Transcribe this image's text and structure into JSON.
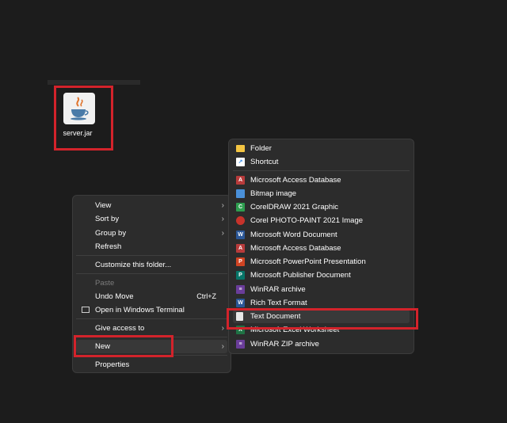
{
  "desktop": {
    "file": {
      "name": "server.jar",
      "icon": "java-icon"
    }
  },
  "context_menu": {
    "items": [
      {
        "label": "View",
        "has_submenu": true
      },
      {
        "label": "Sort by",
        "has_submenu": true
      },
      {
        "label": "Group by",
        "has_submenu": true
      },
      {
        "label": "Refresh"
      },
      {
        "label": "Customize this folder..."
      },
      {
        "label": "Paste",
        "disabled": true
      },
      {
        "label": "Undo Move",
        "shortcut": "Ctrl+Z"
      },
      {
        "label": "Open in Windows Terminal",
        "icon": "terminal-icon"
      },
      {
        "label": "Give access to",
        "has_submenu": true
      },
      {
        "label": "New",
        "has_submenu": true,
        "highlighted": true
      },
      {
        "label": "Properties"
      }
    ]
  },
  "new_submenu": {
    "items": [
      {
        "label": "Folder",
        "icon": "folder-icon",
        "color": "#f4c542"
      },
      {
        "label": "Shortcut",
        "icon": "shortcut-icon",
        "color": "#3b8ee8"
      },
      {
        "label": "Microsoft Access Database",
        "icon": "access-icon",
        "color": "#b83b3b"
      },
      {
        "label": "Bitmap image",
        "icon": "bitmap-icon",
        "color": "#4a90d9"
      },
      {
        "label": "CorelDRAW 2021 Graphic",
        "icon": "coreldraw-icon",
        "color": "#2e9e4f"
      },
      {
        "label": "Corel PHOTO-PAINT 2021 Image",
        "icon": "photopaint-icon",
        "color": "#c8332b"
      },
      {
        "label": "Microsoft Word Document",
        "icon": "word-icon",
        "color": "#2b5797"
      },
      {
        "label": "Microsoft Access Database",
        "icon": "access-icon",
        "color": "#b83b3b"
      },
      {
        "label": "Microsoft PowerPoint Presentation",
        "icon": "powerpoint-icon",
        "color": "#d04423"
      },
      {
        "label": "Microsoft Publisher Document",
        "icon": "publisher-icon",
        "color": "#077568"
      },
      {
        "label": "WinRAR archive",
        "icon": "winrar-icon",
        "color": "#6a3d9a"
      },
      {
        "label": "Rich Text Format",
        "icon": "rtf-icon",
        "color": "#2b5797"
      },
      {
        "label": "Text Document",
        "icon": "text-document-icon",
        "color": "#e8e8e8",
        "highlighted": true
      },
      {
        "label": "Microsoft Excel Worksheet",
        "icon": "excel-icon",
        "color": "#1f7244"
      },
      {
        "label": "WinRAR ZIP archive",
        "icon": "winrar-zip-icon",
        "color": "#6a3d9a"
      }
    ]
  },
  "colors": {
    "highlight_box": "#d3232b",
    "menu_bg": "#2c2c2c",
    "desktop_bg": "#1c1c1c"
  }
}
